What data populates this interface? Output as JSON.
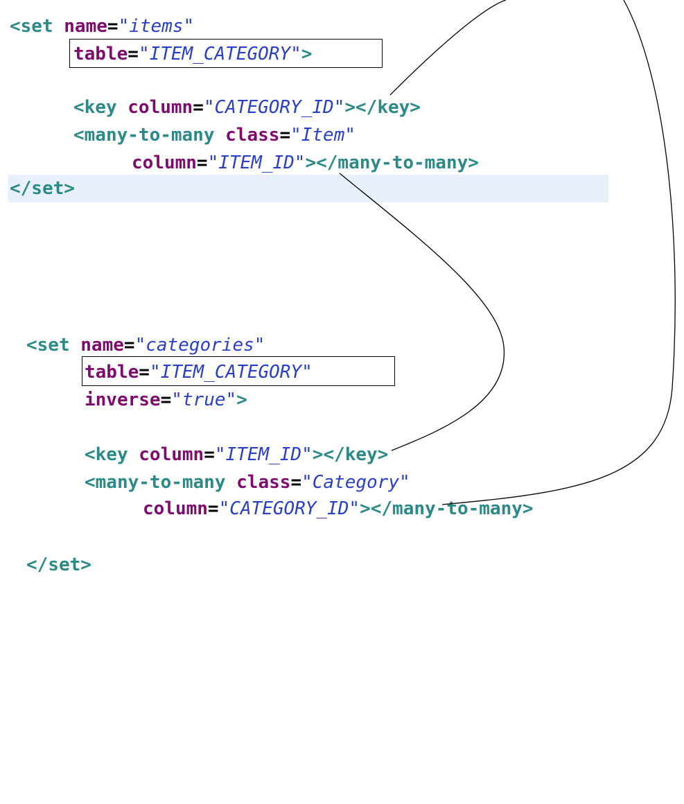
{
  "set_items": {
    "open_tag": "<set",
    "name_attr": "name",
    "name_value": "\"items\"",
    "table_attr": "table",
    "table_value": "\"ITEM_CATEGORY\"",
    "table_close": ">",
    "key_open": "<key",
    "key_attr": "column",
    "key_value": "\"CATEGORY_ID\"",
    "key_close": "></key>",
    "m2m_open": "<many-to-many",
    "m2m_class_attr": "class",
    "m2m_class_value": "\"Item\"",
    "m2m_col_attr": "column",
    "m2m_col_value": "\"ITEM_ID\"",
    "m2m_close": "></many-to-many>",
    "end_tag": "</set>"
  },
  "set_categories": {
    "open_tag": "<set",
    "name_attr": "name",
    "name_value": "\"categories\"",
    "table_attr": "table",
    "table_value": "\"ITEM_CATEGORY\"",
    "inverse_attr": "inverse",
    "inverse_value": "\"true\"",
    "inverse_close": ">",
    "key_open": "<key",
    "key_attr": "column",
    "key_value": "\"ITEM_ID\"",
    "key_close": "></key>",
    "m2m_open": "<many-to-many",
    "m2m_class_attr": "class",
    "m2m_class_value": "\"Category\"",
    "m2m_col_attr": "column",
    "m2m_col_value": "\"CATEGORY_ID\"",
    "m2m_close": "></many-to-many>",
    "end_tag": "</set>"
  },
  "equals": "=",
  "colors": {
    "tag": "#2b8a87",
    "attribute": "#7f0b6f",
    "value": "#2a3fc9",
    "current_line_highlight": "#e8f0fb"
  }
}
